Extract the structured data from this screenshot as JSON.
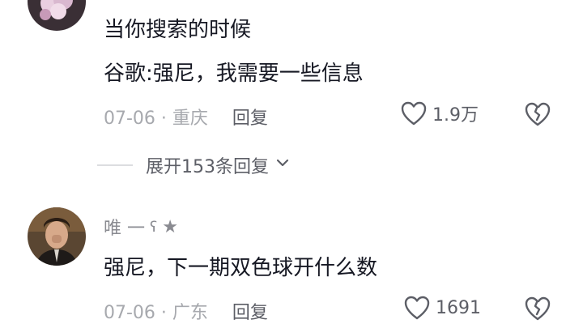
{
  "comment1": {
    "line1": "当你搜索的时候",
    "line2": "谷歌:强尼，我需要一些信息",
    "date": "07-06 · 重庆",
    "reply": "回复",
    "likes": "1.9万"
  },
  "expand": {
    "label": "展开153条回复"
  },
  "comment2": {
    "nickname": "唯 一",
    "text": "强尼，下一期双色球开什么数",
    "date": "07-06 · 广东",
    "reply": "回复",
    "likes": "1691"
  },
  "icons": {
    "like": "heart-outline-icon",
    "dislike": "broken-heart-icon",
    "expand": "chevron-down-icon",
    "badge": "star-icon"
  },
  "colors": {
    "text": "#161823",
    "meta": "#a7a9ae",
    "secondary": "#5c5e66"
  }
}
